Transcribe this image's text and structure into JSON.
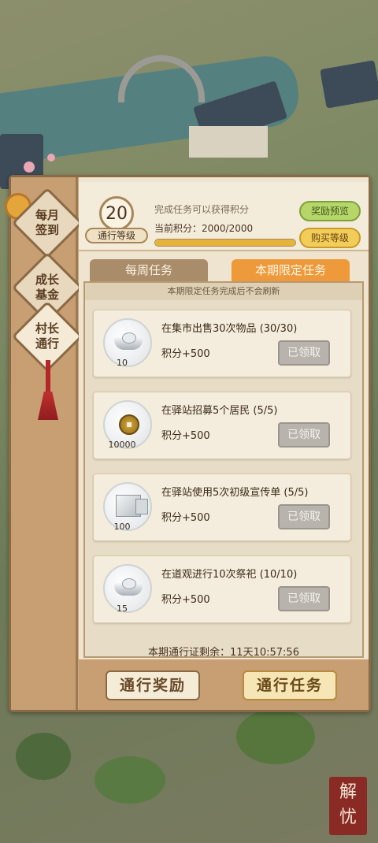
{
  "header": {
    "level": "20",
    "level_label": "通行等级",
    "hint": "完成任务可以获得积分",
    "points_label": "当前积分：",
    "points_value": "2000/2000",
    "progress": 1.0,
    "reward_preview": "奖励预览",
    "buy_level": "购买等级"
  },
  "side_tabs": [
    {
      "label": "每月\n签到",
      "icon": "diamond-tag-icon"
    },
    {
      "label": "成长\n基金",
      "icon": "diamond-tag-icon"
    },
    {
      "label": "村长\n通行",
      "icon": "diamond-tag-icon",
      "active": true
    }
  ],
  "tabs": {
    "weekly": "每周任务",
    "period": "本期限定任务"
  },
  "notice": "本期限定任务完成后不会刷新",
  "tasks": [
    {
      "icon": "silver-ingot-icon",
      "qty": "10",
      "title": "在集市出售30次物品",
      "progress": "(30/30)",
      "reward": "积分+500",
      "button": "已领取"
    },
    {
      "icon": "copper-coin-icon",
      "qty": "10000",
      "title": "在驿站招募5个居民",
      "progress": "(5/5)",
      "reward": "积分+500",
      "button": "已领取"
    },
    {
      "icon": "stone-block-icon",
      "qty": "100",
      "title": "在驿站使用5次初级宣传单",
      "progress": "(5/5)",
      "reward": "积分+500",
      "button": "已领取"
    },
    {
      "icon": "silver-ingot-icon",
      "qty": "15",
      "title": "在道观进行10次祭祀",
      "progress": "(10/10)",
      "reward": "积分+500",
      "button": "已领取"
    }
  ],
  "countdown": {
    "label": "本期通行证剩余：",
    "value": "11天10:57:56"
  },
  "bottom": {
    "reward_button": "通行奖励",
    "task_button": "通行任务"
  },
  "seal_text": "解忧",
  "colors": {
    "panel": "#c9a87f",
    "tab_active": "#ef9a3a",
    "claimed_button": "#b8b4ad"
  }
}
